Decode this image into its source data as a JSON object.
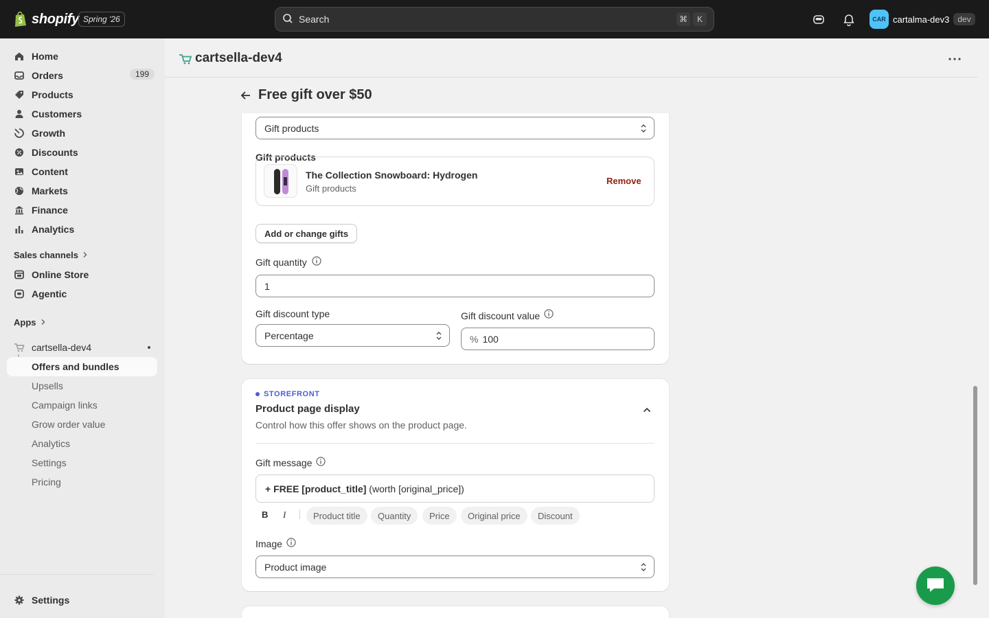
{
  "topbar": {
    "logo_text": "shopify",
    "edition": "Spring '26",
    "search_placeholder": "Search",
    "shortcut_cmd": "⌘",
    "shortcut_key": "K",
    "avatar_initials": "CAR",
    "account_name": "cartalma-dev3",
    "account_badge": "dev"
  },
  "sidebar": {
    "items": [
      {
        "label": "Home",
        "icon": "home-icon"
      },
      {
        "label": "Orders",
        "icon": "inbox-icon",
        "count": "199"
      },
      {
        "label": "Products",
        "icon": "tag-icon"
      },
      {
        "label": "Customers",
        "icon": "person-icon"
      },
      {
        "label": "Growth",
        "icon": "growth-icon"
      },
      {
        "label": "Discounts",
        "icon": "discount-icon"
      },
      {
        "label": "Content",
        "icon": "content-icon"
      },
      {
        "label": "Markets",
        "icon": "globe-icon"
      },
      {
        "label": "Finance",
        "icon": "bank-icon"
      },
      {
        "label": "Analytics",
        "icon": "chart-bar-icon"
      }
    ],
    "sales_channels_label": "Sales channels",
    "channels": [
      {
        "label": "Online Store",
        "icon": "store-icon"
      },
      {
        "label": "Agentic",
        "icon": "agentic-icon"
      }
    ],
    "apps_label": "Apps",
    "app": {
      "name": "cartsella-dev4",
      "sub_items": [
        "Offers and bundles",
        "Upsells",
        "Campaign links",
        "Grow order value",
        "Analytics",
        "Settings",
        "Pricing"
      ]
    },
    "settings_label": "Settings"
  },
  "header": {
    "app_title": "cartsella-dev4",
    "page_title": "Free gift over $50"
  },
  "gift_card": {
    "gift_type_value": "Gift products",
    "gift_products_label": "Gift products",
    "product_name": "The Collection Snowboard: Hydrogen",
    "product_sub": "Gift products",
    "remove_label": "Remove",
    "add_change_label": "Add or change gifts",
    "quantity_label": "Gift quantity",
    "quantity_value": "1",
    "discount_type_label": "Gift discount type",
    "discount_type_value": "Percentage",
    "discount_value_label": "Gift discount value",
    "discount_value_prefix": "%",
    "discount_value": "100"
  },
  "storefront_card": {
    "eyebrow": "STOREFRONT",
    "title": "Product page display",
    "description": "Control how this offer shows on the product page.",
    "gift_message_label": "Gift message",
    "gift_message_bold": "+ FREE [product_title]",
    "gift_message_rest": " (worth [original_price])",
    "format_bold": "B",
    "format_italic": "I",
    "chips": [
      "Product title",
      "Quantity",
      "Price",
      "Original price",
      "Discount"
    ],
    "image_label": "Image",
    "image_value": "Product image"
  }
}
